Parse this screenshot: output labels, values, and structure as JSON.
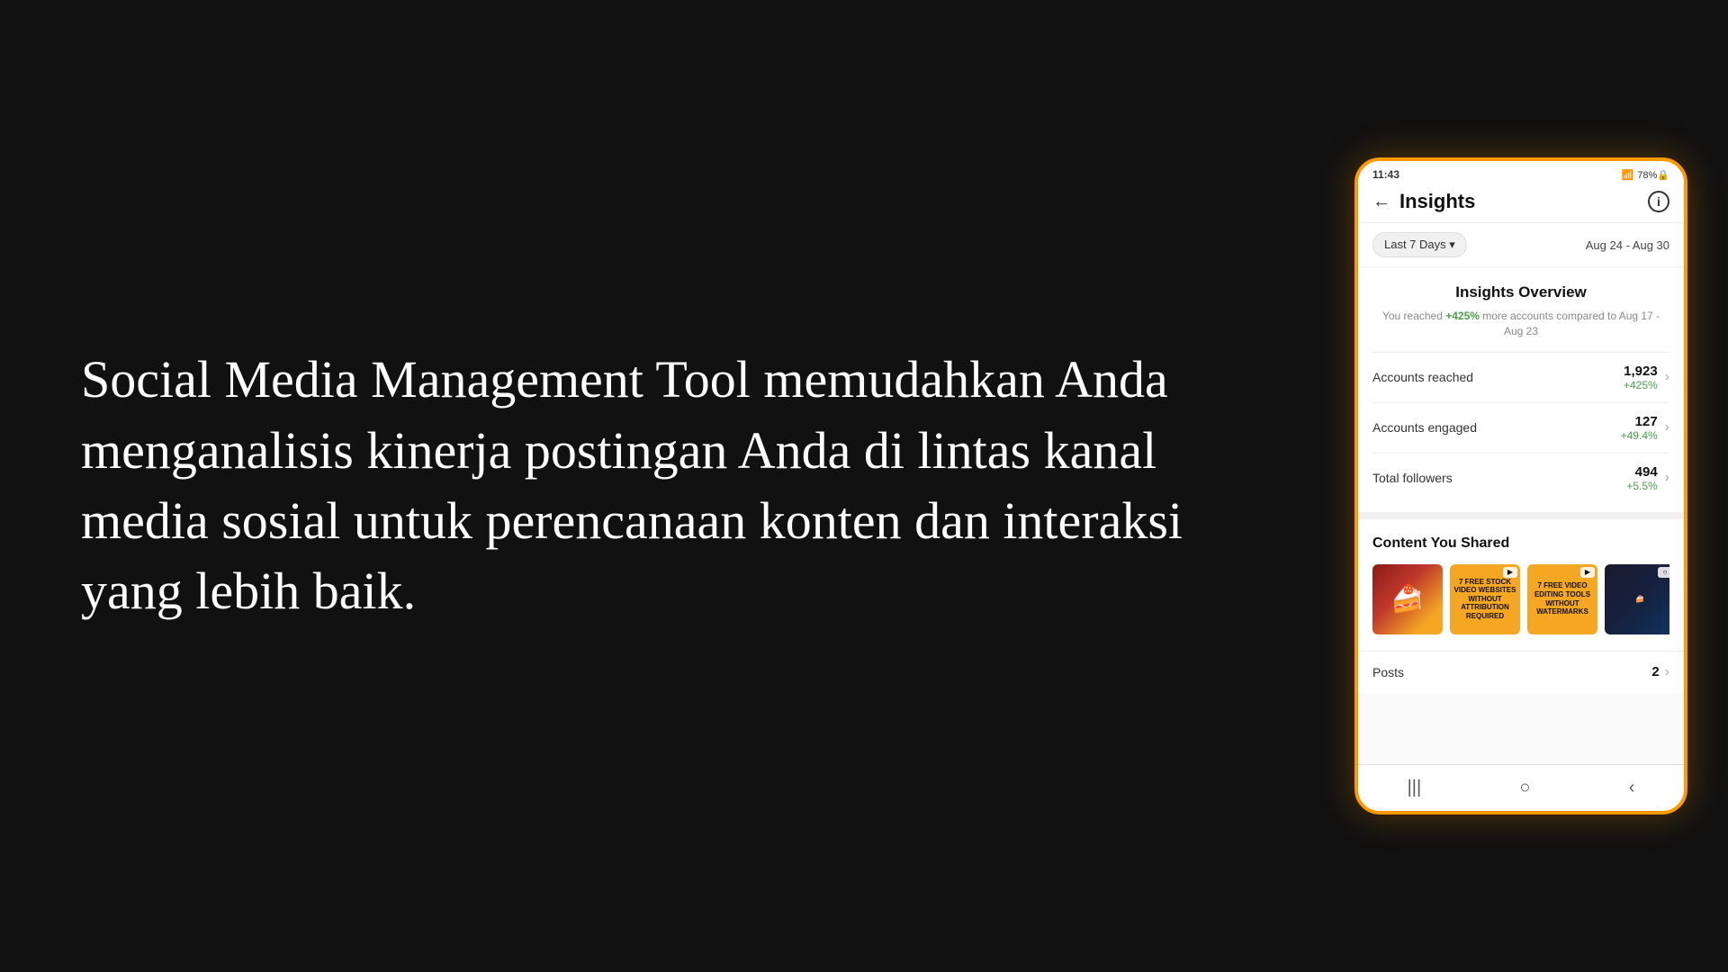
{
  "background": "#111",
  "left": {
    "hero_text": "Social Media Management Tool memudahkan Anda menganalisis kinerja postingan Anda di lintas kanal media sosial untuk perencanaan konten dan interaksi yang lebih baik."
  },
  "phone": {
    "status_bar": {
      "time": "11:43",
      "icons_right": "📶 78%🔒"
    },
    "header": {
      "back_label": "←",
      "title": "Insights",
      "info_label": "i"
    },
    "date_filter": {
      "filter_btn": "Last 7 Days ▾",
      "date_range": "Aug 24 - Aug 30"
    },
    "insights_overview": {
      "title": "Insights Overview",
      "subtitle_pre": "You reached ",
      "highlight": "+425%",
      "subtitle_post": " more accounts compared to Aug 17 - Aug 23"
    },
    "metrics": [
      {
        "label": "Accounts reached",
        "value": "1,923",
        "change": "+425%"
      },
      {
        "label": "Accounts engaged",
        "value": "127",
        "change": "+49.4%"
      },
      {
        "label": "Total followers",
        "value": "494",
        "change": "+5.5%"
      }
    ],
    "content_shared": {
      "title": "Content You Shared",
      "thumbnails": [
        {
          "type": "food",
          "badge": ""
        },
        {
          "type": "video-stock",
          "badge": "▶",
          "text": "7 FREE STOCK VIDEO WEBSITES WITHOUT ATTRIBUTION REQUIRED"
        },
        {
          "type": "video-editing",
          "badge": "▶",
          "text": "7 FREE VIDEO EDITING TOOLS WITHOUT WATERMARKS"
        },
        {
          "type": "dark",
          "badge": "○"
        }
      ]
    },
    "posts": {
      "label": "Posts",
      "value": "2",
      "chevron": "›"
    },
    "bottom_nav": {
      "items": [
        "|||",
        "○",
        "‹"
      ]
    }
  }
}
